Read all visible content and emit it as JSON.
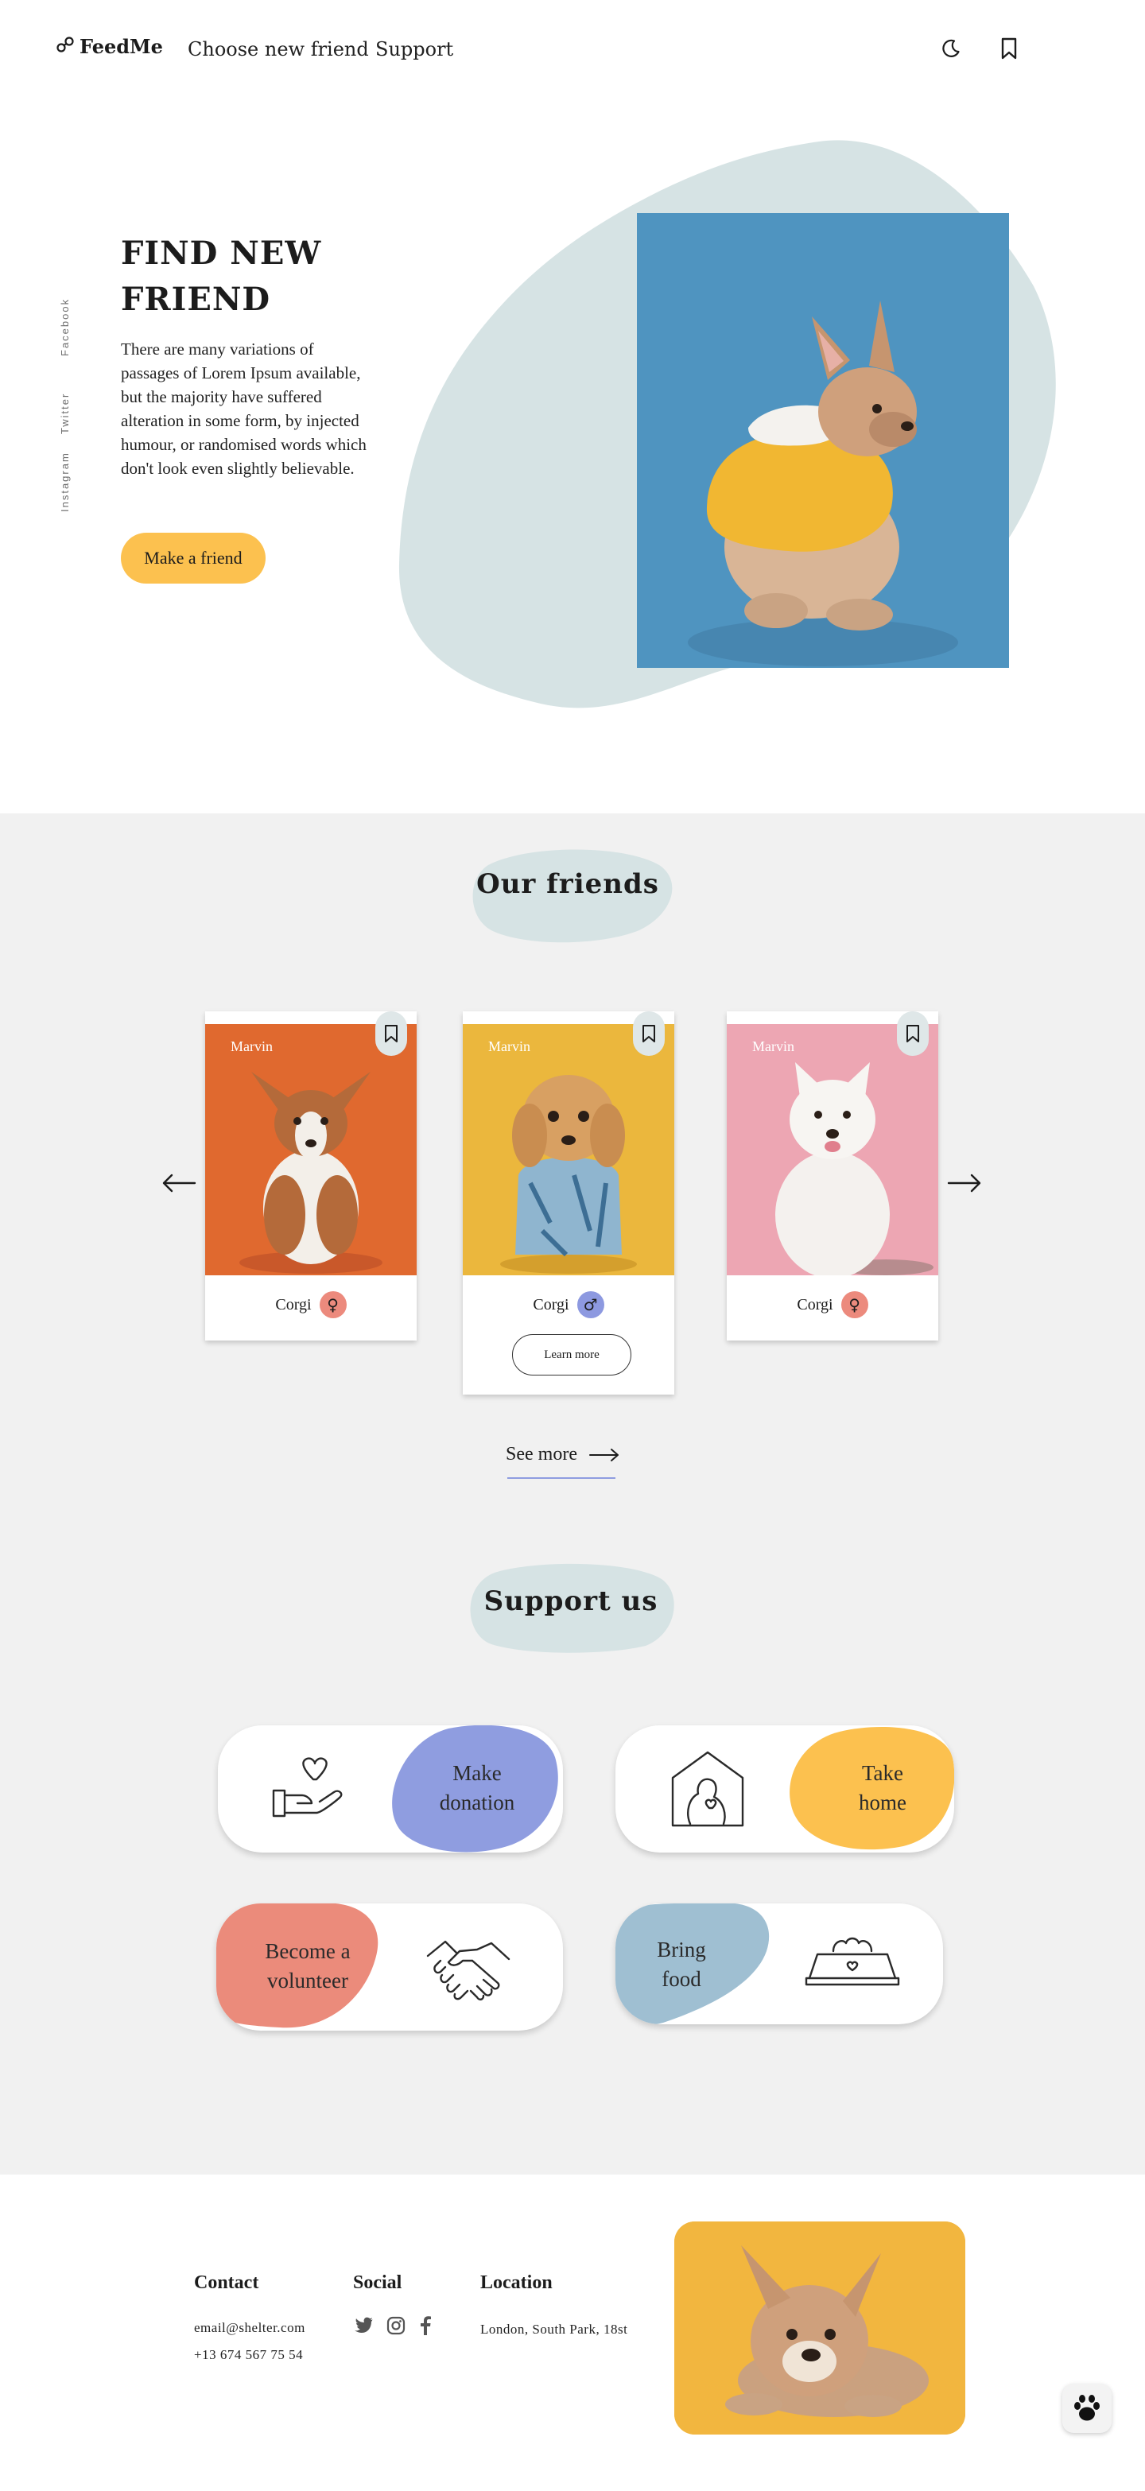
{
  "header": {
    "logo": "FeedMe",
    "logo_icon": "paw-link-icon",
    "nav": [
      "Choose new friend",
      "Support"
    ],
    "icons": [
      "moon-icon",
      "bookmark-icon"
    ]
  },
  "hero": {
    "social": [
      "Instagram",
      "Twitter",
      "Facebook"
    ],
    "title": "FIND NEW FRIEND",
    "text": "There are many variations of passages of Lorem Ipsum available, but the majority have suffered alteration in some form, by injected humour, or randomised words which don't look even slightly believable.",
    "button": "Make a friend",
    "image": "french-bulldog-in-yellow-hoodie"
  },
  "friends": {
    "title": "Our friends",
    "cards": [
      {
        "name": "Marvin",
        "breed": "Corgi",
        "sex": "female",
        "sex_symbol": "♀",
        "sex_color": "#ec8a7d",
        "bg": "#e0692f",
        "image": "corgi-puppy"
      },
      {
        "name": "Marvin",
        "breed": "Corgi",
        "sex": "male",
        "sex_symbol": "♂",
        "sex_color": "#8d99e0",
        "bg": "#ebb73d",
        "image": "poodle-in-shirt",
        "button": "Learn more"
      },
      {
        "name": "Marvin",
        "breed": "Corgi",
        "sex": "female",
        "sex_symbol": "♀",
        "sex_color": "#ec8a7d",
        "bg": "#eda6b3",
        "image": "samoyed"
      }
    ],
    "see_more": "See more"
  },
  "support": {
    "title": "Support us",
    "items": [
      {
        "label_line1": "Make",
        "label_line2": "donation",
        "icon": "heart-hand-icon",
        "color": "#8f9de0"
      },
      {
        "label_line1": "Take",
        "label_line2": "home",
        "icon": "pet-house-icon",
        "color": "#fcc14f"
      },
      {
        "label_line1": "Become a",
        "label_line2": "volunteer",
        "icon": "handshake-icon",
        "color": "#eb8b7b"
      },
      {
        "label_line1": "Bring",
        "label_line2": "food",
        "icon": "food-bowl-icon",
        "color": "#9fbfd2"
      }
    ]
  },
  "footer": {
    "contact": {
      "title": "Contact",
      "email": "email@shelter.com",
      "phone": "+13 674 567 75 54"
    },
    "social": {
      "title": "Social",
      "icons": [
        "twitter-icon",
        "instagram-icon",
        "facebook-icon"
      ]
    },
    "location": {
      "title": "Location",
      "address": "London, South Park, 18st"
    },
    "image": "bulldog-lying-on-yellow"
  },
  "colors": {
    "accent_yellow": "#fcc14f",
    "blob_gray": "#d6e3e4",
    "section_bg": "#f1f1f1"
  }
}
